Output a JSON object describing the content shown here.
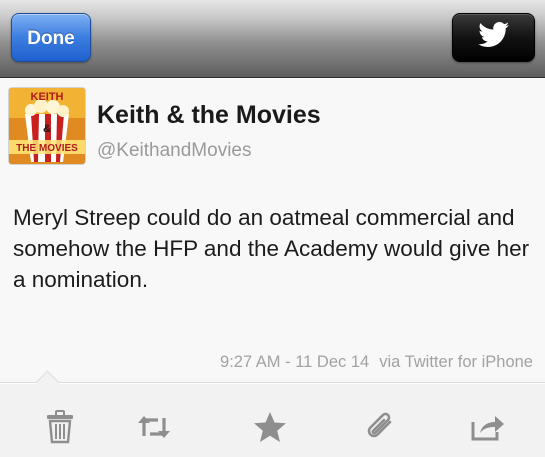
{
  "navbar": {
    "done_label": "Done",
    "twitter_icon": "twitter-bird-icon"
  },
  "tweet": {
    "display_name": "Keith & the Movies",
    "handle": "@KeithandMovies",
    "avatar": {
      "line1": "KEITH",
      "line2": "&",
      "line3": "THE MOVIES"
    },
    "text": "Meryl Streep could do an oatmeal commercial and somehow the HFP and the Academy would give her a nomination.",
    "timestamp": "9:27 AM - 11 Dec 14",
    "via": "via Twitter for iPhone"
  },
  "toolbar": {
    "icons": [
      "trash-icon",
      "retweet-icon",
      "star-icon",
      "paperclip-icon",
      "share-icon"
    ]
  },
  "colors": {
    "done_blue": "#2f72d9",
    "text": "#1c1c1c",
    "muted": "#9a9a9a",
    "icon_gray": "#8e8e8e"
  }
}
